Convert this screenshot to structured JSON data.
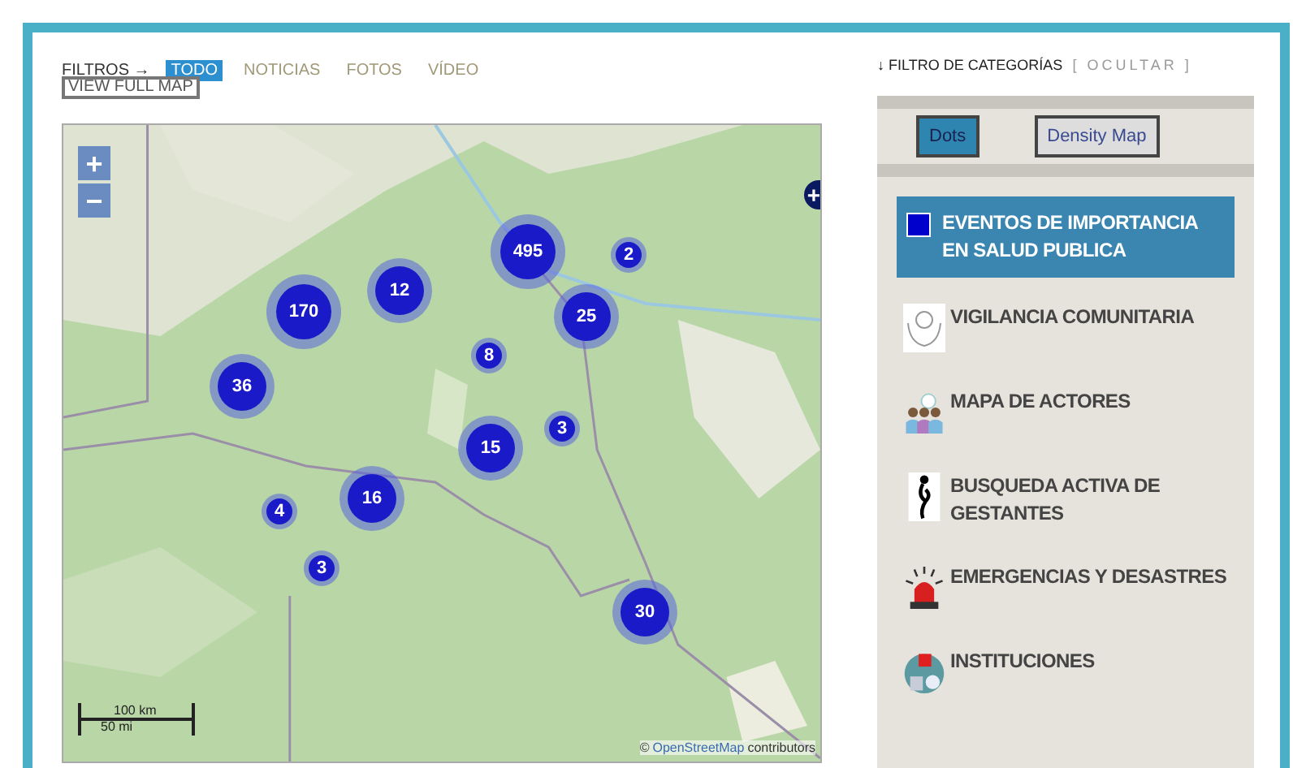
{
  "filters": {
    "label": "FILTROS →",
    "tabs": [
      {
        "label": "TODO",
        "selected": true
      },
      {
        "label": "NOTICIAS",
        "selected": false
      },
      {
        "label": "FOTOS",
        "selected": false
      },
      {
        "label": "VÍDEO",
        "selected": false
      }
    ],
    "full_map_button": "VIEW FULL MAP"
  },
  "map": {
    "zoom_in": "+",
    "zoom_out": "−",
    "layers_button": "+",
    "scale": [
      "100 km",
      "50 mi"
    ],
    "attribution_prefix": "©",
    "attribution_link": "OpenStreetMap",
    "attribution_suffix": "contributors",
    "clusters": [
      {
        "count": "495"
      },
      {
        "count": "2"
      },
      {
        "count": "170"
      },
      {
        "count": "12"
      },
      {
        "count": "25"
      },
      {
        "count": "8"
      },
      {
        "count": "36"
      },
      {
        "count": "15"
      },
      {
        "count": "3"
      },
      {
        "count": "16"
      },
      {
        "count": "4"
      },
      {
        "count": "3"
      },
      {
        "count": "30"
      }
    ]
  },
  "categories": {
    "title": "↓ FILTRO DE CATEGORÍAS",
    "toggle": "[ OCULTAR ]",
    "modes": [
      {
        "label": "Dots",
        "selected": true
      },
      {
        "label": "Density Map",
        "selected": false
      }
    ],
    "items": [
      {
        "label": "EVENTOS DE IMPORTANCIA EN SALUD PUBLICA",
        "kind": "square",
        "selected": true,
        "color": "#0000cc"
      },
      {
        "label": "VIGILANCIA COMUNITARIA",
        "kind": "hands",
        "selected": false
      },
      {
        "label": "MAPA DE ACTORES",
        "kind": "people",
        "selected": false
      },
      {
        "label": "BUSQUEDA ACTIVA DE GESTANTES",
        "kind": "figure",
        "selected": false
      },
      {
        "label": "EMERGENCIAS Y DESASTRES",
        "kind": "siren",
        "selected": false
      },
      {
        "label": "INSTITUCIONES",
        "kind": "hospital",
        "selected": false
      }
    ]
  }
}
